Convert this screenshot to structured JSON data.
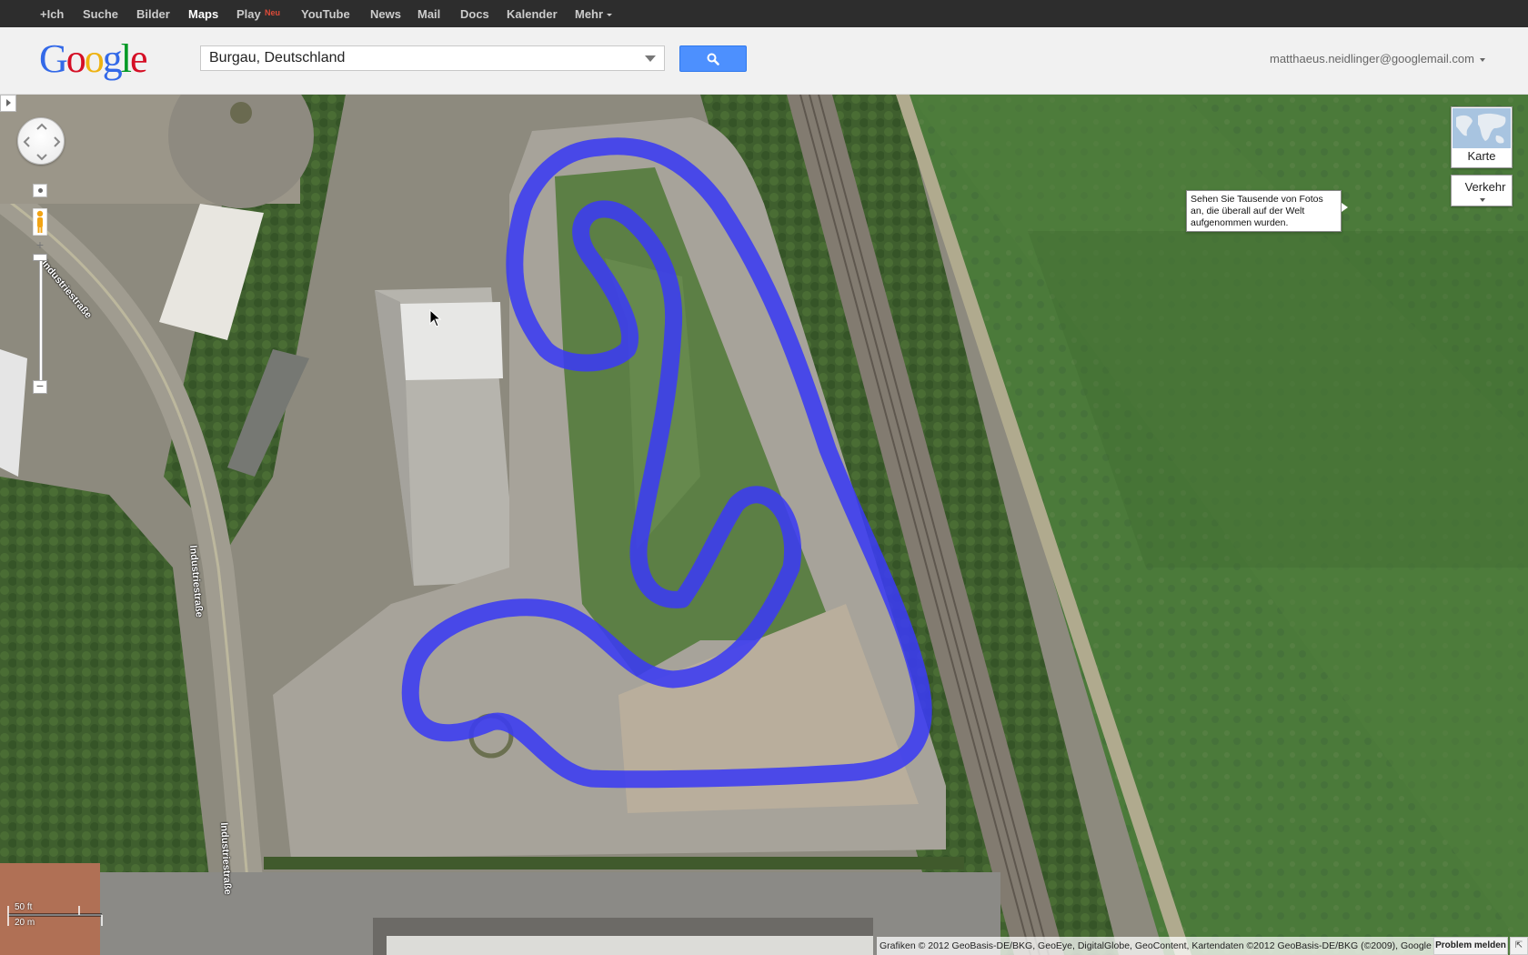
{
  "gbar": {
    "items": [
      "+Ich",
      "Suche",
      "Bilder",
      "Maps",
      "Play",
      "YouTube",
      "News",
      "Mail",
      "Docs",
      "Kalender",
      "Mehr"
    ],
    "play_badge": "Neu"
  },
  "header": {
    "logo": "Google",
    "search_value": "Burgau, Deutschland",
    "account": "matthaeus.neidlinger@googlemail.com"
  },
  "map": {
    "type_button": "Karte",
    "traffic_button": "Verkehr",
    "photo_tip": "Sehen Sie Tausende von Fotos an, die überall auf der Welt aufgenommen wurden.",
    "road_labels": [
      "Industriestraße",
      "Industriestraße",
      "Industriestraße"
    ],
    "scale_ft": "50 ft",
    "scale_m": "20 m",
    "attribution": "Grafiken © 2012 GeoBasis-DE/BKG, GeoEye, DigitalGlobe, GeoContent, Kartendaten ©2012 GeoBasis-DE/BKG (©2009), Google -",
    "report_problem": "Problem melden",
    "route_color": "#3b3bf2"
  }
}
